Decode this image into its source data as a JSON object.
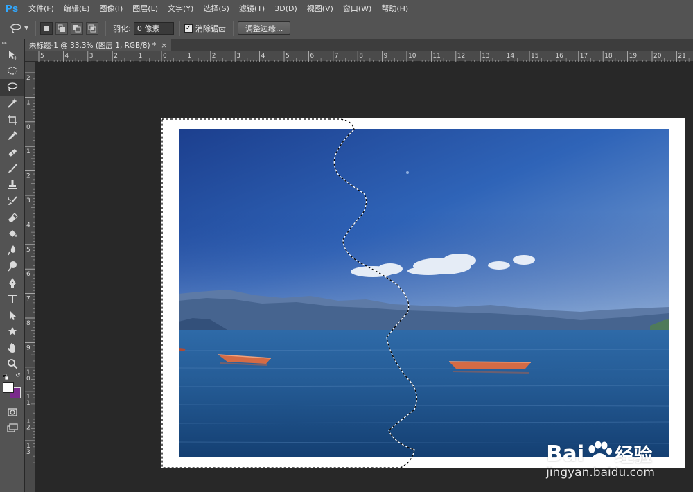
{
  "app": {
    "logo": "Ps"
  },
  "menu": [
    "文件(F)",
    "编辑(E)",
    "图像(I)",
    "图层(L)",
    "文字(Y)",
    "选择(S)",
    "滤镜(T)",
    "3D(D)",
    "视图(V)",
    "窗口(W)",
    "帮助(H)"
  ],
  "options": {
    "feather_label": "羽化:",
    "feather_value": "0 像素",
    "antialias_label": "消除锯齿",
    "antialias_checked": true,
    "refine_edge": "调整边缘..."
  },
  "document": {
    "tab_title": "未标题-1 @ 33.3% (图层 1, RGB/8) *",
    "close": "×"
  },
  "rulers": {
    "top_labels": [
      "5",
      "4",
      "3",
      "2",
      "1",
      "0",
      "1",
      "2",
      "3",
      "4",
      "5",
      "6",
      "7",
      "8",
      "9",
      "10",
      "11",
      "12",
      "13",
      "14",
      "15",
      "16",
      "17",
      "18",
      "19",
      "20",
      "21"
    ],
    "left_labels": [
      "2",
      "1",
      "0",
      "1",
      "2",
      "3",
      "4",
      "5",
      "6",
      "7",
      "8",
      "9",
      "10",
      "11",
      "12",
      "13"
    ]
  },
  "colors": {
    "foreground": "#ffffff",
    "background": "#7a2a8c",
    "accent": "#31a8ff"
  },
  "watermark": {
    "brand": "Bai",
    "brand_suffix": "经验",
    "site": "jingyan.baidu.com"
  },
  "tools": [
    "move-tool",
    "marquee-tool",
    "lasso-tool",
    "quick-select-tool",
    "crop-tool",
    "eyedropper-tool",
    "healing-tool",
    "brush-tool",
    "clone-stamp-tool",
    "history-brush-tool",
    "eraser-tool",
    "paint-bucket-tool",
    "blur-tool",
    "dodge-tool",
    "pen-tool",
    "type-tool",
    "path-select-tool",
    "shape-tool",
    "hand-tool",
    "zoom-tool"
  ]
}
